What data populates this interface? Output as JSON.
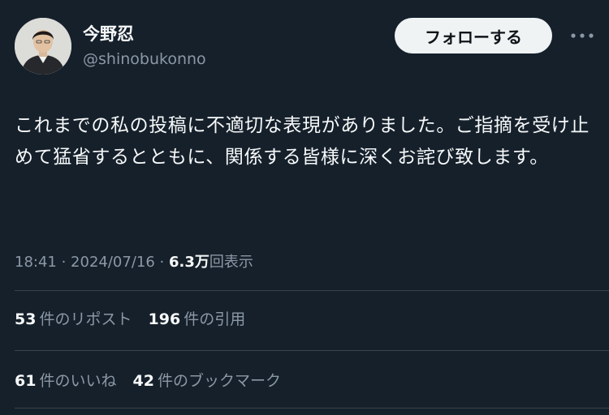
{
  "user": {
    "display_name": "今野忍",
    "handle": "@shinobukonno"
  },
  "header": {
    "follow_label": "フォローする",
    "more_icon": "more-horizontal-icon"
  },
  "tweet": {
    "text": "これまでの私の投稿に不適切な表現がありました。ご指摘を受け止めて猛省するとともに、関係する皆様に深くお詫び致します。"
  },
  "meta": {
    "time": "18:41",
    "separator": " · ",
    "date": "2024/07/16",
    "views_count": "6.3万",
    "views_label": "回表示"
  },
  "stats": {
    "reposts_count": "53",
    "reposts_label": "件のリポスト",
    "quotes_count": "196",
    "quotes_label": "件の引用",
    "likes_count": "61",
    "likes_label": "件のいいね",
    "bookmarks_count": "42",
    "bookmarks_label": "件のブックマーク"
  },
  "colors": {
    "background": "#15202b",
    "primary_text": "#f7f9f9",
    "secondary_text": "#8b98a5",
    "divider": "#38444d",
    "follow_button_bg": "#eff3f4"
  }
}
